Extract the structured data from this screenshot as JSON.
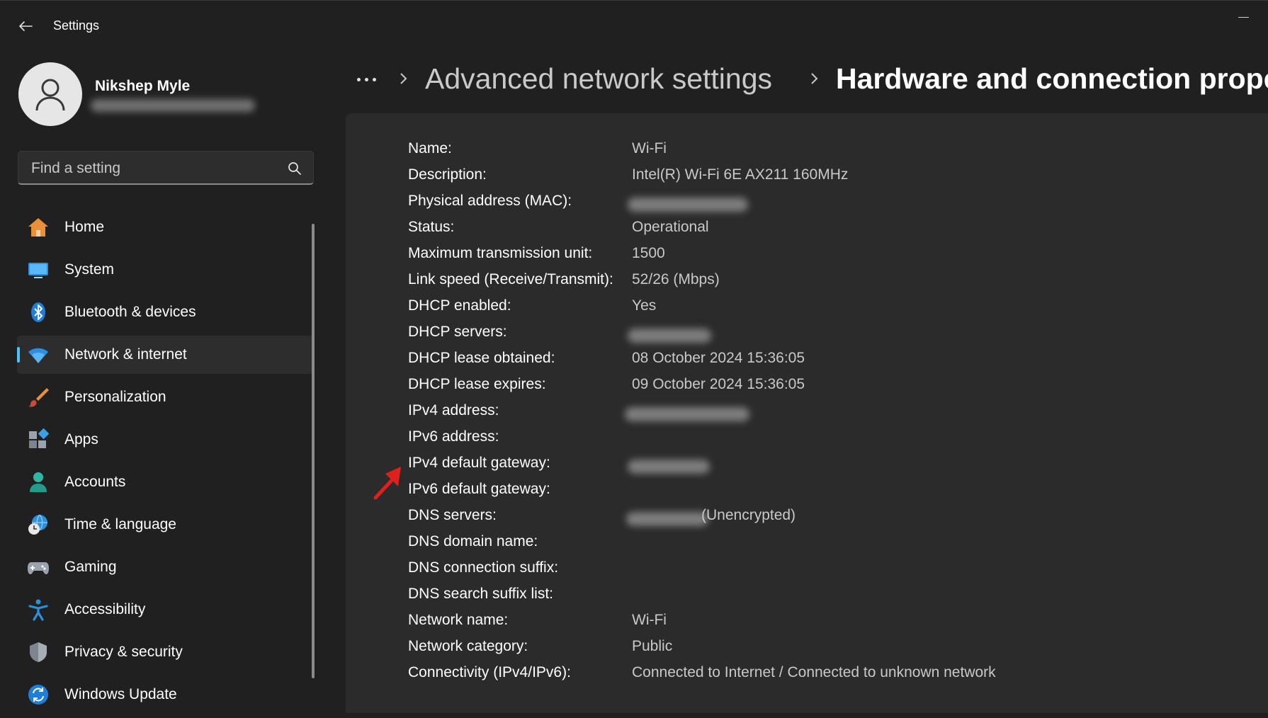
{
  "window": {
    "title": "Settings"
  },
  "profile": {
    "name": "Nikshep Myle"
  },
  "search": {
    "placeholder": "Find a setting"
  },
  "nav": {
    "items": [
      {
        "label": "Home",
        "icon": "home-icon"
      },
      {
        "label": "System",
        "icon": "system-icon"
      },
      {
        "label": "Bluetooth & devices",
        "icon": "bluetooth-icon"
      },
      {
        "label": "Network & internet",
        "icon": "wifi-icon",
        "active": true
      },
      {
        "label": "Personalization",
        "icon": "brush-icon"
      },
      {
        "label": "Apps",
        "icon": "apps-icon"
      },
      {
        "label": "Accounts",
        "icon": "accounts-icon"
      },
      {
        "label": "Time & language",
        "icon": "globe-clock-icon"
      },
      {
        "label": "Gaming",
        "icon": "gamepad-icon"
      },
      {
        "label": "Accessibility",
        "icon": "accessibility-icon"
      },
      {
        "label": "Privacy & security",
        "icon": "shield-icon"
      },
      {
        "label": "Windows Update",
        "icon": "update-icon"
      }
    ]
  },
  "breadcrumb": {
    "parent": "Advanced network settings",
    "current": "Hardware and connection prope"
  },
  "properties": [
    {
      "label": "Name:",
      "value": "Wi-Fi"
    },
    {
      "label": "Description:",
      "value": "Intel(R) Wi-Fi 6E AX211 160MHz"
    },
    {
      "label": "Physical address (MAC):",
      "value": ""
    },
    {
      "label": "Status:",
      "value": "Operational"
    },
    {
      "label": "Maximum transmission unit:",
      "value": "1500"
    },
    {
      "label": "Link speed (Receive/Transmit):",
      "value": "52/26 (Mbps)"
    },
    {
      "label": "DHCP enabled:",
      "value": "Yes"
    },
    {
      "label": "DHCP servers:",
      "value": ""
    },
    {
      "label": "DHCP lease obtained:",
      "value": "08 October 2024 15:36:05"
    },
    {
      "label": "DHCP lease expires:",
      "value": "09 October 2024 15:36:05"
    },
    {
      "label": "IPv4 address:",
      "value": ""
    },
    {
      "label": "IPv6 address:",
      "value": ""
    },
    {
      "label": "IPv4 default gateway:",
      "value": ""
    },
    {
      "label": "IPv6 default gateway:",
      "value": ""
    },
    {
      "label": "DNS servers:",
      "value": "(Unencrypted)"
    },
    {
      "label": "DNS domain name:",
      "value": ""
    },
    {
      "label": "DNS connection suffix:",
      "value": ""
    },
    {
      "label": "DNS search suffix list:",
      "value": ""
    },
    {
      "label": "Network name:",
      "value": "Wi-Fi"
    },
    {
      "label": "Network category:",
      "value": "Public"
    },
    {
      "label": "Connectivity (IPv4/IPv6):",
      "value": "Connected to Internet / Connected to unknown network"
    }
  ],
  "colors": {
    "accent": "#4cc2ff",
    "annotation_arrow": "#e0201c"
  }
}
